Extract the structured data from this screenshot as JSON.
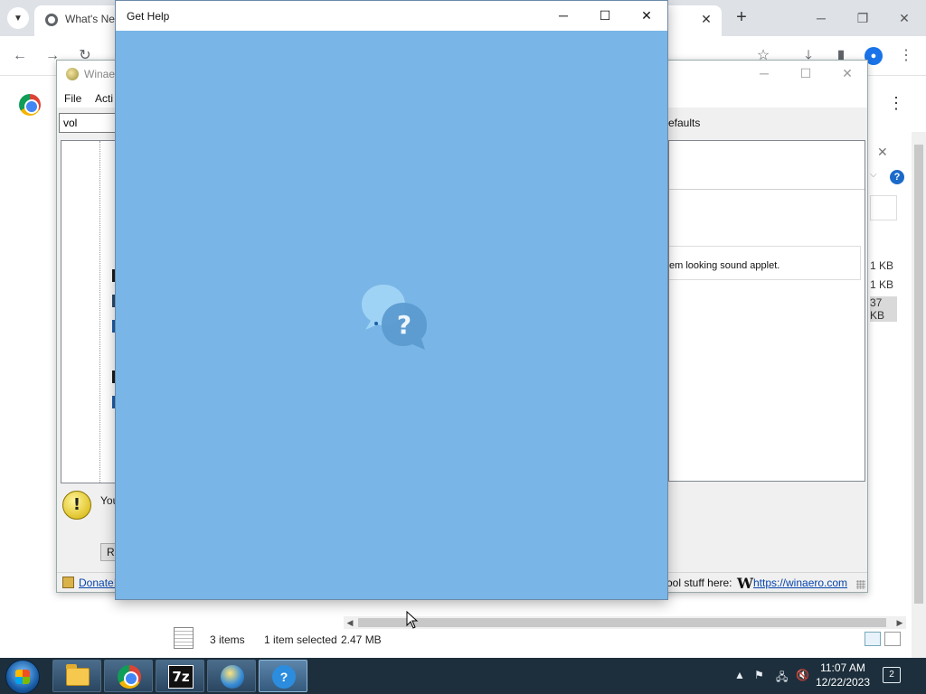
{
  "browser": {
    "tab_title": "What's Ne",
    "tab_close": "✕",
    "new_tab": "+",
    "min_glyph": "─",
    "restore_glyph": "❐",
    "close_glyph": "✕"
  },
  "winaero": {
    "title": "Winae",
    "menu": {
      "file": "File",
      "action": "Acti"
    },
    "search_value": "vol",
    "defaults_label": "efaults",
    "description": "em looking sound applet.",
    "warning_text": "You",
    "reset_button": "Re",
    "donate_link": "Donate!",
    "cool_stuff_text": "ool stuff here:",
    "w_logo": "W",
    "site_link": "https://winaero.com"
  },
  "side_panel": {
    "sizes": [
      "1 KB",
      "1 KB",
      "37 KB"
    ],
    "help_glyph": "?",
    "close_glyph": "✕"
  },
  "explorer": {
    "items_count": "3 items",
    "selected": "1 item selected",
    "size": "2.47 MB"
  },
  "gethelp": {
    "title": "Get Help",
    "min_glyph": "─",
    "max_glyph": "☐",
    "close_glyph": "✕",
    "splash_glyph": "?"
  },
  "taskbar": {
    "apps": [
      "file-explorer",
      "chrome",
      "7-zip",
      "winaero-tweaker",
      "get-help"
    ],
    "sevenz_label": "7z",
    "gethelp_label": "?",
    "time": "11:07 AM",
    "date": "12/22/2023",
    "notifications": "2"
  },
  "colors": {
    "gethelp_bg": "#79b5e6",
    "taskbar_bg": "#1d2f3c",
    "link": "#0645ad"
  }
}
